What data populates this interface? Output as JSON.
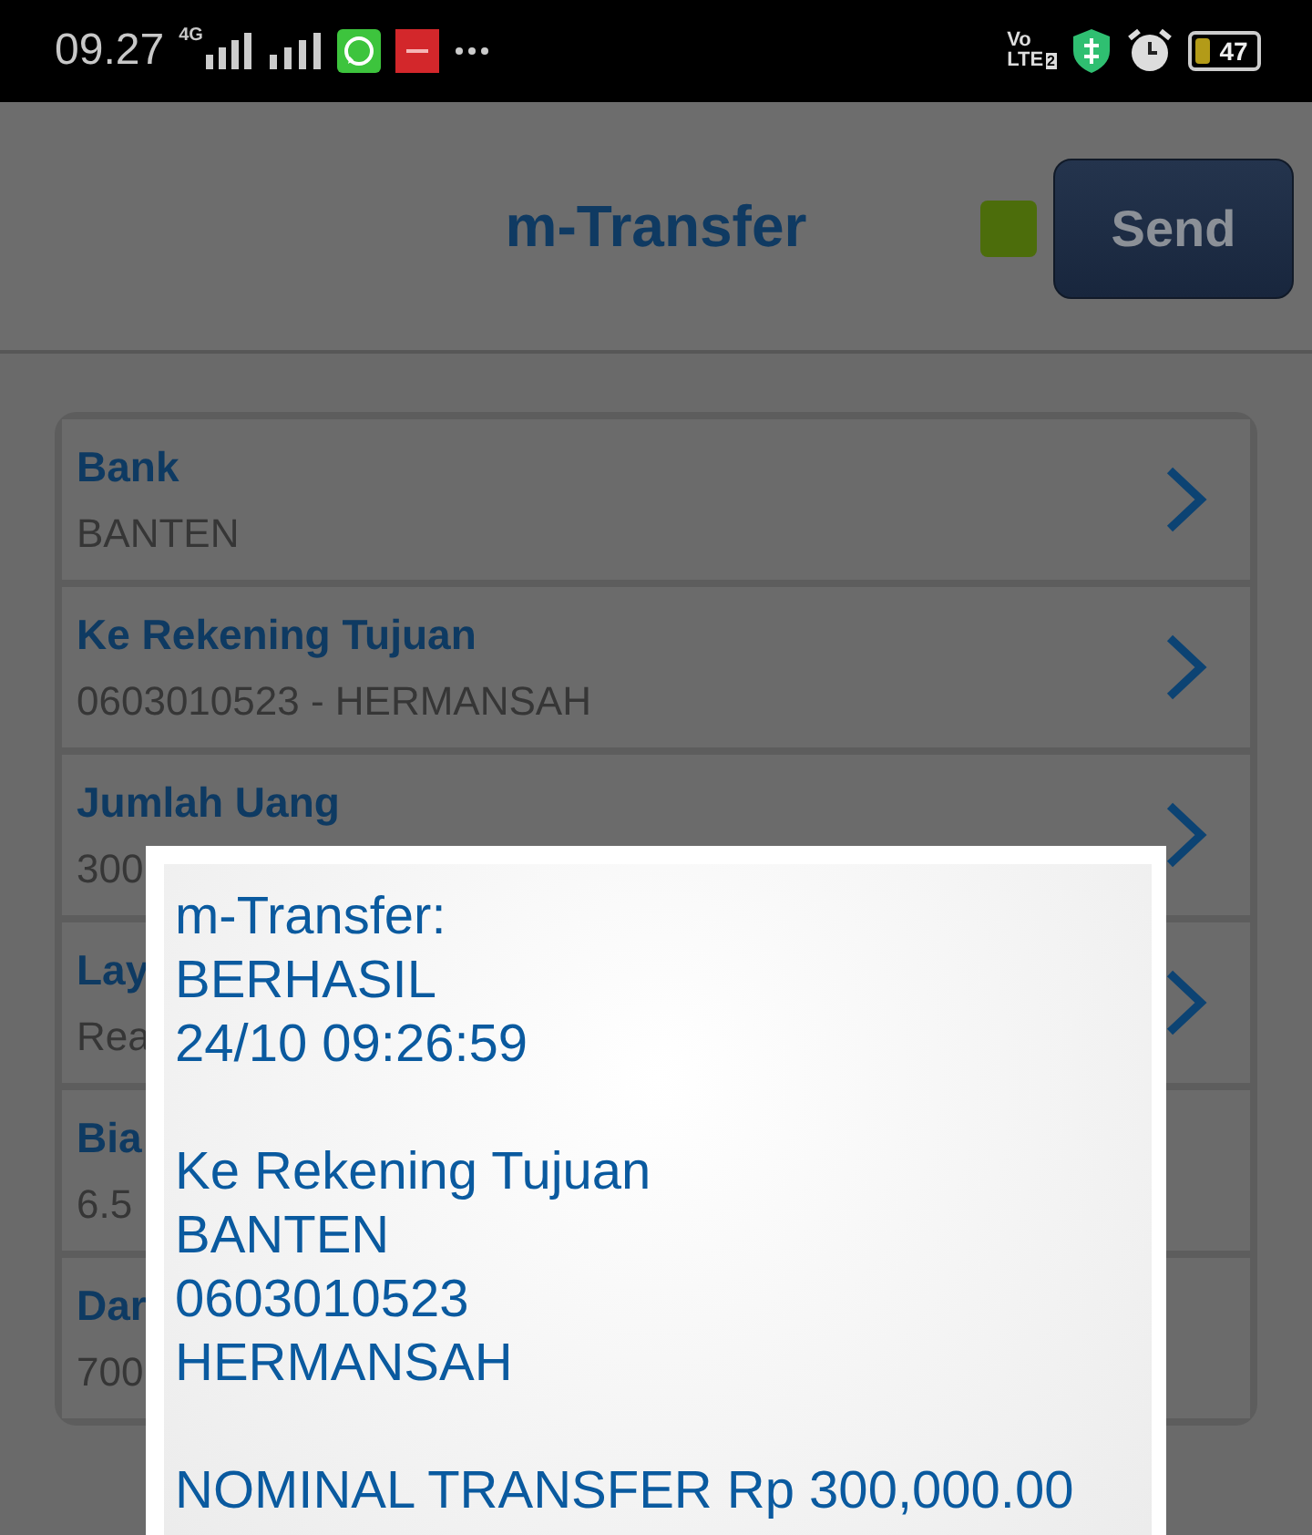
{
  "status_bar": {
    "time": "09.27",
    "network": "4G",
    "volte": "Vo",
    "lte": "LTE",
    "sim": "2",
    "battery": "47"
  },
  "header": {
    "title": "m-Transfer",
    "send_button": "Send"
  },
  "rows": [
    {
      "label": "Bank",
      "value": "BANTEN",
      "chevron": true
    },
    {
      "label": "Ke Rekening Tujuan",
      "value": "0603010523 - HERMANSAH",
      "chevron": true
    },
    {
      "label": "Jumlah Uang",
      "value": "300",
      "chevron": true
    },
    {
      "label": "Lay",
      "value": "Rea",
      "chevron": true
    },
    {
      "label": "Bia",
      "value": "6.5",
      "chevron": false
    },
    {
      "label": "Dar",
      "value": "700",
      "chevron": false
    }
  ],
  "dialog": {
    "paragraphs": [
      [
        "m-Transfer:",
        "BERHASIL",
        "24/10 09:26:59"
      ],
      [
        "Ke Rekening Tujuan",
        "BANTEN",
        "0603010523",
        "HERMANSAH"
      ],
      [
        "NOMINAL TRANSFER Rp 300,000.00"
      ]
    ]
  }
}
